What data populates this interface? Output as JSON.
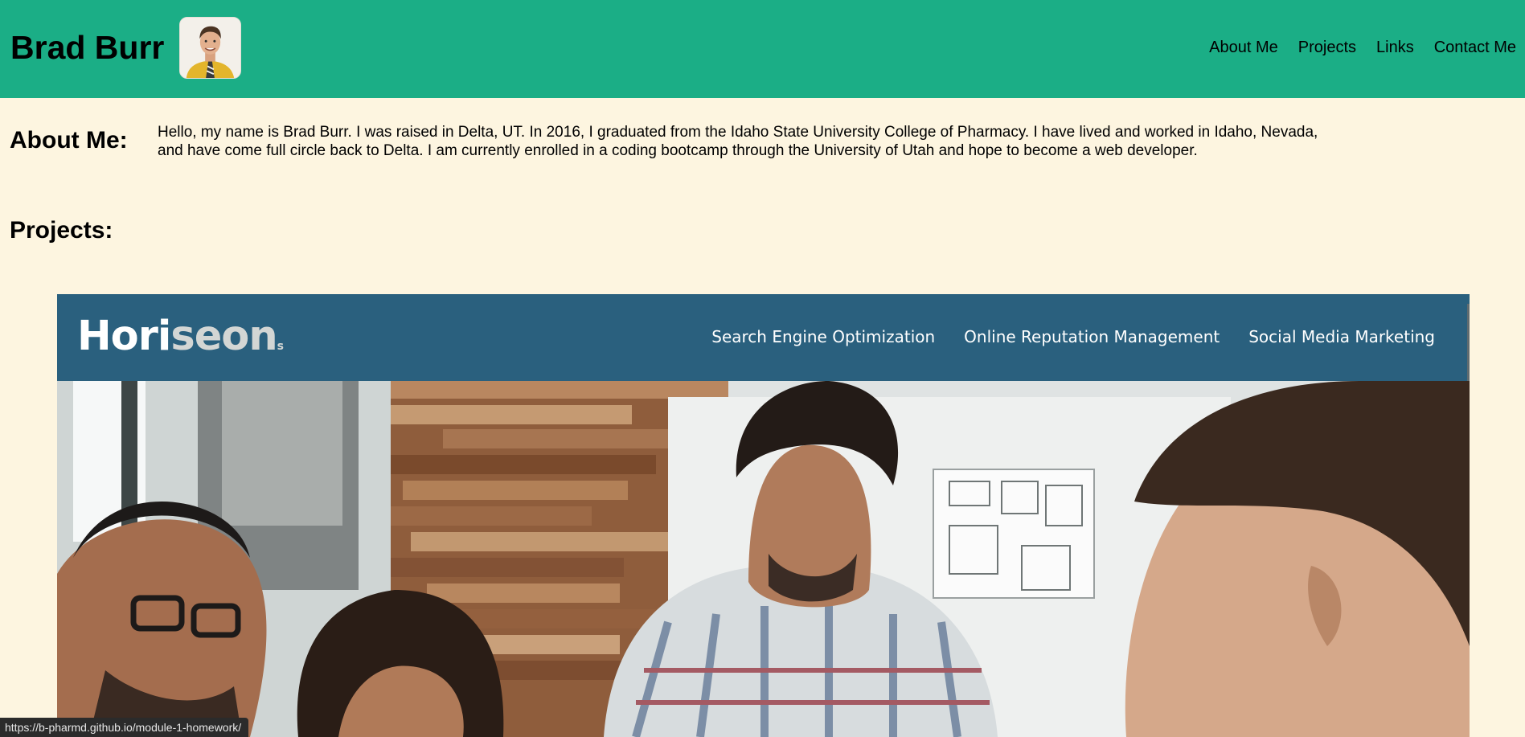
{
  "header": {
    "site_name": "Brad Burr",
    "avatar_alt": "Photo of Brad Burr",
    "nav": [
      "About Me",
      "Projects",
      "Links",
      "Contact Me"
    ]
  },
  "about": {
    "heading": "About Me:",
    "text": "Hello, my name is Brad Burr. I was raised in Delta, UT. In 2016, I graduated from the Idaho State University College of Pharmacy. I have lived and worked in Idaho, Nevada, and have come full circle back to Delta. I am currently enrolled in a coding bootcamp through the University of Utah and hope to become a web developer."
  },
  "projects": {
    "heading": "Projects:",
    "items": [
      {
        "logo_primary": "Hori",
        "logo_accent": "seon",
        "logo_mark": "s",
        "nav": [
          "Search Engine Optimization",
          "Online Reputation Management",
          "Social Media Marketing"
        ]
      }
    ]
  },
  "status_bar": {
    "url": "https://b-pharmd.github.io/module-1-homework/"
  },
  "colors": {
    "header_bg": "#1bae86",
    "page_bg": "#fdf5e0",
    "project_header_bg": "#2a607e"
  }
}
